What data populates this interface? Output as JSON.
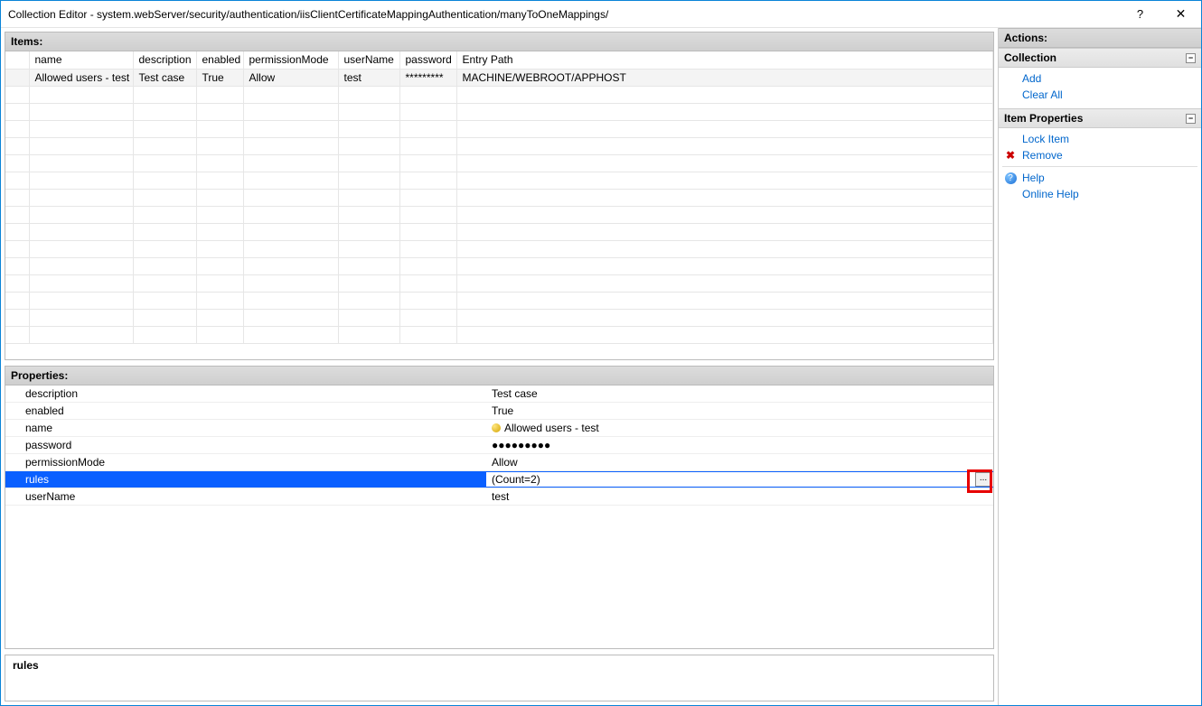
{
  "window": {
    "title": "Collection Editor - system.webServer/security/authentication/iisClientCertificateMappingAuthentication/manyToOneMappings/"
  },
  "items_header": "Items:",
  "properties_header": "Properties:",
  "columns": {
    "name": "name",
    "description": "description",
    "enabled": "enabled",
    "permissionMode": "permissionMode",
    "userName": "userName",
    "password": "password",
    "entryPath": "Entry Path"
  },
  "rows": [
    {
      "name": "Allowed users - test",
      "description": "Test case",
      "enabled": "True",
      "permissionMode": "Allow",
      "userName": "test",
      "password": "*********",
      "entryPath": "MACHINE/WEBROOT/APPHOST"
    }
  ],
  "properties": {
    "description": {
      "label": "description",
      "value": "Test case"
    },
    "enabled": {
      "label": "enabled",
      "value": "True"
    },
    "name": {
      "label": "name",
      "value": "Allowed users - test"
    },
    "password": {
      "label": "password",
      "value": "●●●●●●●●●"
    },
    "permissionMode": {
      "label": "permissionMode",
      "value": "Allow"
    },
    "rules": {
      "label": "rules",
      "value": "(Count=2)"
    },
    "userName": {
      "label": "userName",
      "value": "test"
    }
  },
  "description_panel": {
    "title": "rules",
    "text": ""
  },
  "actions": {
    "header": "Actions:",
    "collection": {
      "title": "Collection",
      "add": "Add",
      "clear": "Clear All"
    },
    "item": {
      "title": "Item Properties",
      "lock": "Lock Item",
      "remove": "Remove",
      "help": "Help",
      "online": "Online Help"
    }
  },
  "glyphs": {
    "ellipsis": "...",
    "minus": "−",
    "close": "✕",
    "help": "?"
  }
}
